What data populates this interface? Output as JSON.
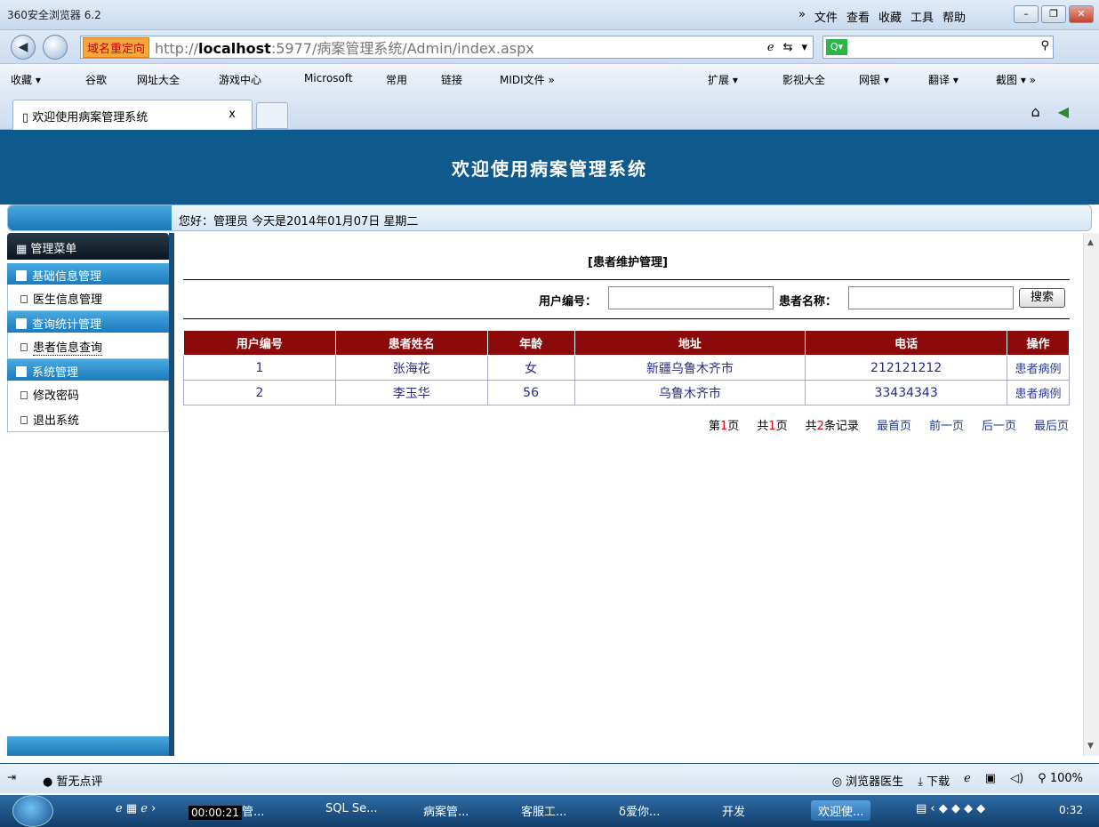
{
  "browser": {
    "title": "360安全浏览器 6.2",
    "menus": [
      "»",
      "文件",
      "查看",
      "收藏",
      "工具",
      "帮助"
    ],
    "redirect_label": "域名重定向",
    "url_prefix": "http://",
    "url_host": "localhost",
    "url_rest": ":5977/病案管理系统/Admin/index.aspx",
    "favorites": [
      "收藏 ▾",
      "谷歌",
      "网址大全",
      "游戏中心",
      "Microsoft",
      "常用",
      "链接",
      "MIDI文件 »"
    ],
    "favorites_right": [
      "扩展 ▾",
      "影视大全",
      "网银 ▾",
      "翻译 ▾",
      "截图 ▾ »"
    ],
    "tab_title": "欢迎使用病案管理系统",
    "tab_close": "x"
  },
  "app": {
    "banner_title": "欢迎使用病案管理系统",
    "greeting": "您好：管理员   今天是2014年01月07日   星期二"
  },
  "sidebar": {
    "header": "管理菜单",
    "sections": [
      {
        "label": "基础信息管理",
        "items": [
          "医生信息管理"
        ]
      },
      {
        "label": "查询统计管理",
        "items": [
          "患者信息查询"
        ]
      },
      {
        "label": "系统管理",
        "items": [
          "修改密码",
          "退出系统"
        ]
      }
    ]
  },
  "main": {
    "page_title": "[患者维护管理]",
    "filter": {
      "user_id_label": "用户编号：",
      "user_id_value": "",
      "patient_name_label": "患者名称：",
      "patient_name_value": "",
      "search_button": "搜索"
    },
    "table": {
      "columns": [
        "用户编号",
        "患者姓名",
        "年龄",
        "地址",
        "电话",
        "操作"
      ],
      "rows": [
        {
          "id": "1",
          "name": "张海花",
          "age": "女",
          "address": "新疆乌鲁木齐市",
          "phone": "212121212",
          "action": "患者病例"
        },
        {
          "id": "2",
          "name": "李玉华",
          "age": "56",
          "address": "乌鲁木齐市",
          "phone": "33434343",
          "action": "患者病例"
        }
      ]
    },
    "pager": {
      "page_prefix": "第",
      "page_current": "1",
      "page_suffix": "页",
      "total_prefix": "共",
      "total_pages": "1",
      "total_suffix": "页",
      "records_prefix": "共",
      "records": "2",
      "records_suffix": "条记录",
      "first": "最首页",
      "prev": "前一页",
      "next": "后一页",
      "last": "最后页"
    }
  },
  "statusbar": {
    "rating": "暂无点评",
    "items": [
      "浏览器医生",
      "下载",
      "100%"
    ]
  },
  "taskbar": {
    "timer": "00:00:21",
    "tasks": [
      "管...",
      "SQL Se...",
      "病案管...",
      "客服工...",
      "δ爱你...",
      "开发",
      "欢迎使..."
    ],
    "clock": "0:32"
  }
}
